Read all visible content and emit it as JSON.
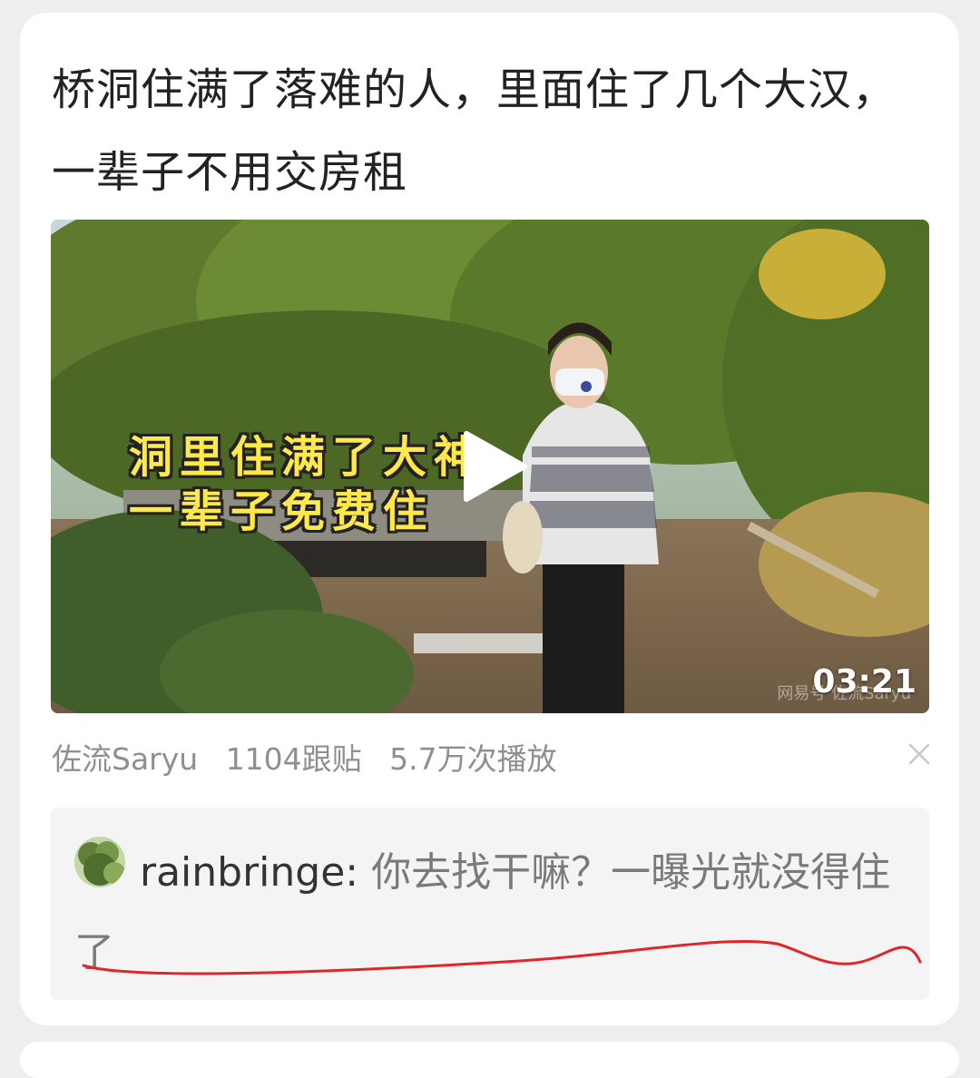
{
  "post": {
    "title": "桥洞住满了落难的人，里面住了几个大汉，一辈子不用交房租",
    "video": {
      "overlay_line1": "洞里住满了大神",
      "overlay_line2": "一辈子免费住",
      "duration": "03:21",
      "watermark": "网易号 佐流Saryu"
    },
    "meta": {
      "author": "佐流Saryu",
      "replies": "1104跟贴",
      "plays": "5.7万次播放"
    },
    "comment": {
      "username": "rainbringe:",
      "text": " 你去找干嘛？一曝光就没得住了"
    }
  },
  "colors": {
    "overlay_yellow": "#ffe94a",
    "underline_red": "#e0262b",
    "meta_gray": "#8f8f8f",
    "comment_bg": "#f4f4f4"
  },
  "icons": {
    "play": "play-icon",
    "close": "close-icon",
    "avatar": "avatar"
  }
}
